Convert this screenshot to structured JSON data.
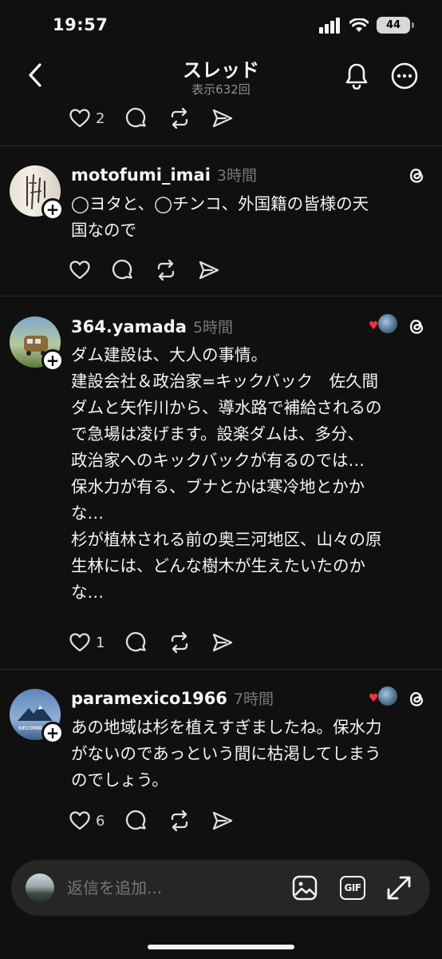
{
  "status_bar": {
    "time": "19:57",
    "battery": "44"
  },
  "header": {
    "title": "スレッド",
    "subtitle": "表示632回"
  },
  "top_post": {
    "like_count": "2"
  },
  "posts": [
    {
      "username": "motofumi_imai",
      "time": "3時間",
      "text": "◯ヨタと、◯チンコ、外国籍の皆様の天\n国なので",
      "like_count": ""
    },
    {
      "username": "364.yamada",
      "time": "5時間",
      "text": "ダム建設は、大人の事情。\n建設会社＆政治家=キックバック　佐久間\nダムと矢作川から、導水路で補給されるの\nで急場は凌げます。設楽ダムは、多分、\n政治家へのキックバックが有るのでは…\n保水力が有る、ブナとかは寒冷地とかか\nな…\n杉が植林される前の奥三河地区、山々の原\n生林には、どんな樹木が生えたいたのか\nな…",
      "like_count": "1"
    },
    {
      "username": "paramexico1966",
      "time": "7時間",
      "text": "あの地域は杉を植えすぎましたね。保水力\nがないのであっという間に枯渇してしまう\nのでしょう。",
      "like_count": "6"
    }
  ],
  "avatar_text": {
    "paramexico": "SECOND EN"
  },
  "composer": {
    "placeholder": "返信を追加...",
    "gif_label": "GIF"
  },
  "icons": [
    "back-chevron-icon",
    "bell-icon",
    "more-icon",
    "heart-icon",
    "comment-icon",
    "repost-icon",
    "share-icon",
    "threads-icon",
    "image-icon",
    "gif-icon",
    "expand-icon"
  ],
  "colors": {
    "background": "#101010",
    "text": "#f3f5f7",
    "muted": "#777777",
    "heart": "#ff3040"
  }
}
